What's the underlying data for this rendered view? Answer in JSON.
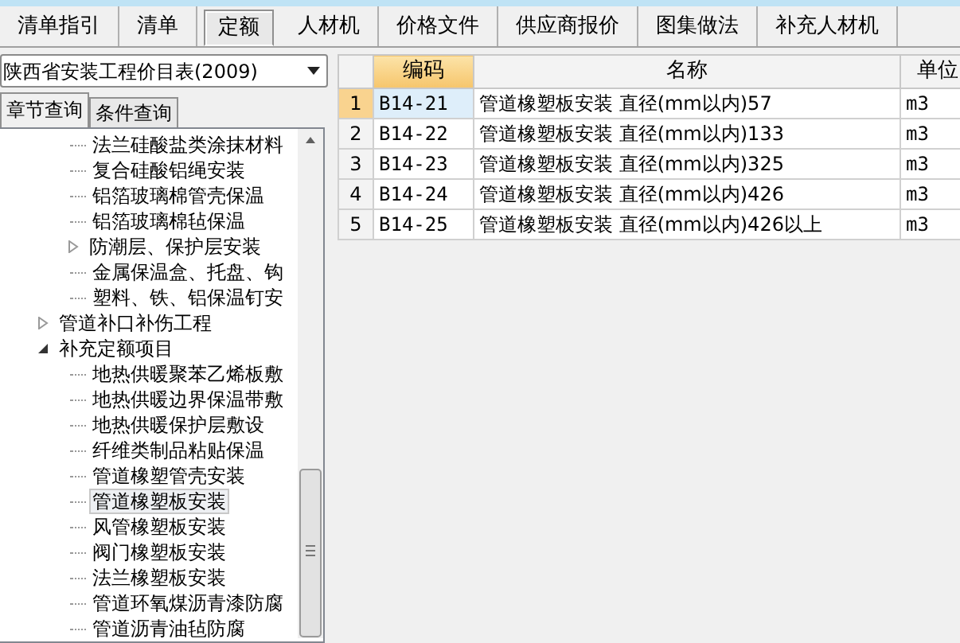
{
  "tabs": [
    {
      "label": "清单指引",
      "selected": false
    },
    {
      "label": "清单",
      "selected": false
    },
    {
      "label": "定额",
      "selected": true
    },
    {
      "label": "人材机",
      "selected": false
    },
    {
      "label": "价格文件",
      "selected": false
    },
    {
      "label": "供应商报价",
      "selected": false
    },
    {
      "label": "图集做法",
      "selected": false
    },
    {
      "label": "补充人材机",
      "selected": false
    }
  ],
  "library_select": {
    "value": "陕西省安装工程价目表(2009)"
  },
  "search_tabs": [
    {
      "label": "章节查询",
      "selected": true
    },
    {
      "label": "条件查询",
      "selected": false
    }
  ],
  "tree": {
    "continued_items": [
      {
        "label": "法兰硅酸盐类涂抹材料",
        "selected": false
      },
      {
        "label": "复合硅酸铝绳安装",
        "selected": false
      },
      {
        "label": "铝箔玻璃棉管壳保温",
        "selected": false
      },
      {
        "label": "铝箔玻璃棉毡保温",
        "selected": false
      },
      {
        "label": "防潮层、保护层安装",
        "expanded": false,
        "selected": false
      },
      {
        "label": "金属保温盒、托盘、钩",
        "selected": false
      },
      {
        "label": "塑料、铁、铝保温钉安",
        "selected": false
      }
    ],
    "items": [
      {
        "label": "管道补口补伤工程",
        "expanded": false,
        "selected": false
      },
      {
        "label": "补充定额项目",
        "expanded": true,
        "selected": false,
        "children": [
          {
            "label": "地热供暖聚苯乙烯板敷",
            "selected": false
          },
          {
            "label": "地热供暖边界保温带敷",
            "selected": false
          },
          {
            "label": "地热供暖保护层敷设",
            "selected": false
          },
          {
            "label": "纤维类制品粘贴保温",
            "selected": false
          },
          {
            "label": "管道橡塑管壳安装",
            "selected": false
          },
          {
            "label": "管道橡塑板安装",
            "selected": true
          },
          {
            "label": "风管橡塑板安装",
            "selected": false
          },
          {
            "label": "阀门橡塑板安装",
            "selected": false
          },
          {
            "label": "法兰橡塑板安装",
            "selected": false
          },
          {
            "label": "管道环氧煤沥青漆防腐",
            "selected": false
          },
          {
            "label": "管道沥青油毡防腐",
            "selected": false
          }
        ]
      }
    ]
  },
  "table": {
    "columns": [
      {
        "label": "编码",
        "sorted": true
      },
      {
        "label": "名称",
        "sorted": false
      },
      {
        "label": "单位",
        "sorted": false
      }
    ],
    "rows": [
      {
        "number": "1",
        "cells": [
          "B14-21",
          "管道橡塑板安装 直径(mm以内)57",
          "m3"
        ],
        "selected": true
      },
      {
        "number": "2",
        "cells": [
          "B14-22",
          "管道橡塑板安装 直径(mm以内)133",
          "m3"
        ],
        "selected": false
      },
      {
        "number": "3",
        "cells": [
          "B14-23",
          "管道橡塑板安装 直径(mm以内)325",
          "m3"
        ],
        "selected": false
      },
      {
        "number": "4",
        "cells": [
          "B14-24",
          "管道橡塑板安装 直径(mm以内)426",
          "m3"
        ],
        "selected": false
      },
      {
        "number": "5",
        "cells": [
          "B14-25",
          "管道橡塑板安装 直径(mm以内)426以上",
          "m3"
        ],
        "selected": false
      }
    ]
  }
}
